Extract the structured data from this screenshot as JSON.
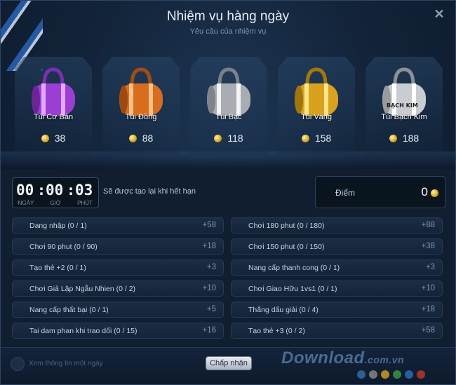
{
  "header": {
    "title": "Nhiệm vụ hàng ngày",
    "subtitle": "Yêu cầu của nhiệm vụ",
    "close_icon": "close-icon"
  },
  "bags": [
    {
      "name": "Túi Cơ Bản",
      "reward": "38",
      "color": "#9b3fd4",
      "stripe": "#e3a9ff"
    },
    {
      "name": "Túi Đồng",
      "reward": "88",
      "color": "#d96d1f",
      "stripe": "#ffc08a"
    },
    {
      "name": "Túi Bạc",
      "reward": "118",
      "color": "#a9adb3",
      "stripe": "#f4f4f4"
    },
    {
      "name": "Túi Vàng",
      "reward": "158",
      "color": "#d9a21e",
      "stripe": "#ffe48a"
    },
    {
      "name": "Túi Bạch Kim",
      "reward": "188",
      "color": "#c9ccd0",
      "stripe": "#ffffff",
      "logo_text": "BẠCH KIM"
    }
  ],
  "timer": {
    "hours": "00",
    "minutes": "00",
    "seconds": "03",
    "label_hours": "NGÀY",
    "label_minutes": "GIỜ",
    "label_seconds": "PHÚT",
    "note": "Sẽ được tạo lại khi hết hạn"
  },
  "points": {
    "label": "Điểm",
    "value": "0"
  },
  "tasks_left": [
    {
      "label": "Dang nhập (0 / 1)",
      "points": "+58"
    },
    {
      "label": "Chơi 90 phut (0 / 90)",
      "points": "+18"
    },
    {
      "label": "Tạo thẻ +2 (0 / 1)",
      "points": "+3"
    },
    {
      "label": "Chơi Giả Lập Ngẫu Nhien (0 / 2)",
      "points": "+10"
    },
    {
      "label": "Nang cấp thất bại (0 / 1)",
      "points": "+5"
    },
    {
      "label": "Tai dam phan khi trao dổi (0 / 15)",
      "points": "+16"
    }
  ],
  "tasks_right": [
    {
      "label": "Chơi 180 phut (0 / 180)",
      "points": "+88"
    },
    {
      "label": "Chơi 150 phut (0 / 150)",
      "points": "+38"
    },
    {
      "label": "Nang cấp thanh cong (0 / 1)",
      "points": "+3"
    },
    {
      "label": "Chơi Giao Hữu 1vs1 (0 / 1)",
      "points": "+10"
    },
    {
      "label": "Thắng dấu giải (0 / 4)",
      "points": "+18"
    },
    {
      "label": "Tạo thẻ +3 (0 / 2)",
      "points": "+58"
    }
  ],
  "footer": {
    "checkbox_label": "Xem thông tin một ngày",
    "accept_label": "Chấp nhận",
    "watermark": "Download",
    "watermark_suffix": ".com.vn",
    "dot_colors": [
      "#3b6ea8",
      "#8c8c8c",
      "#d9a21e",
      "#3f9a4a",
      "#2c6fbf",
      "#c0392b"
    ]
  }
}
